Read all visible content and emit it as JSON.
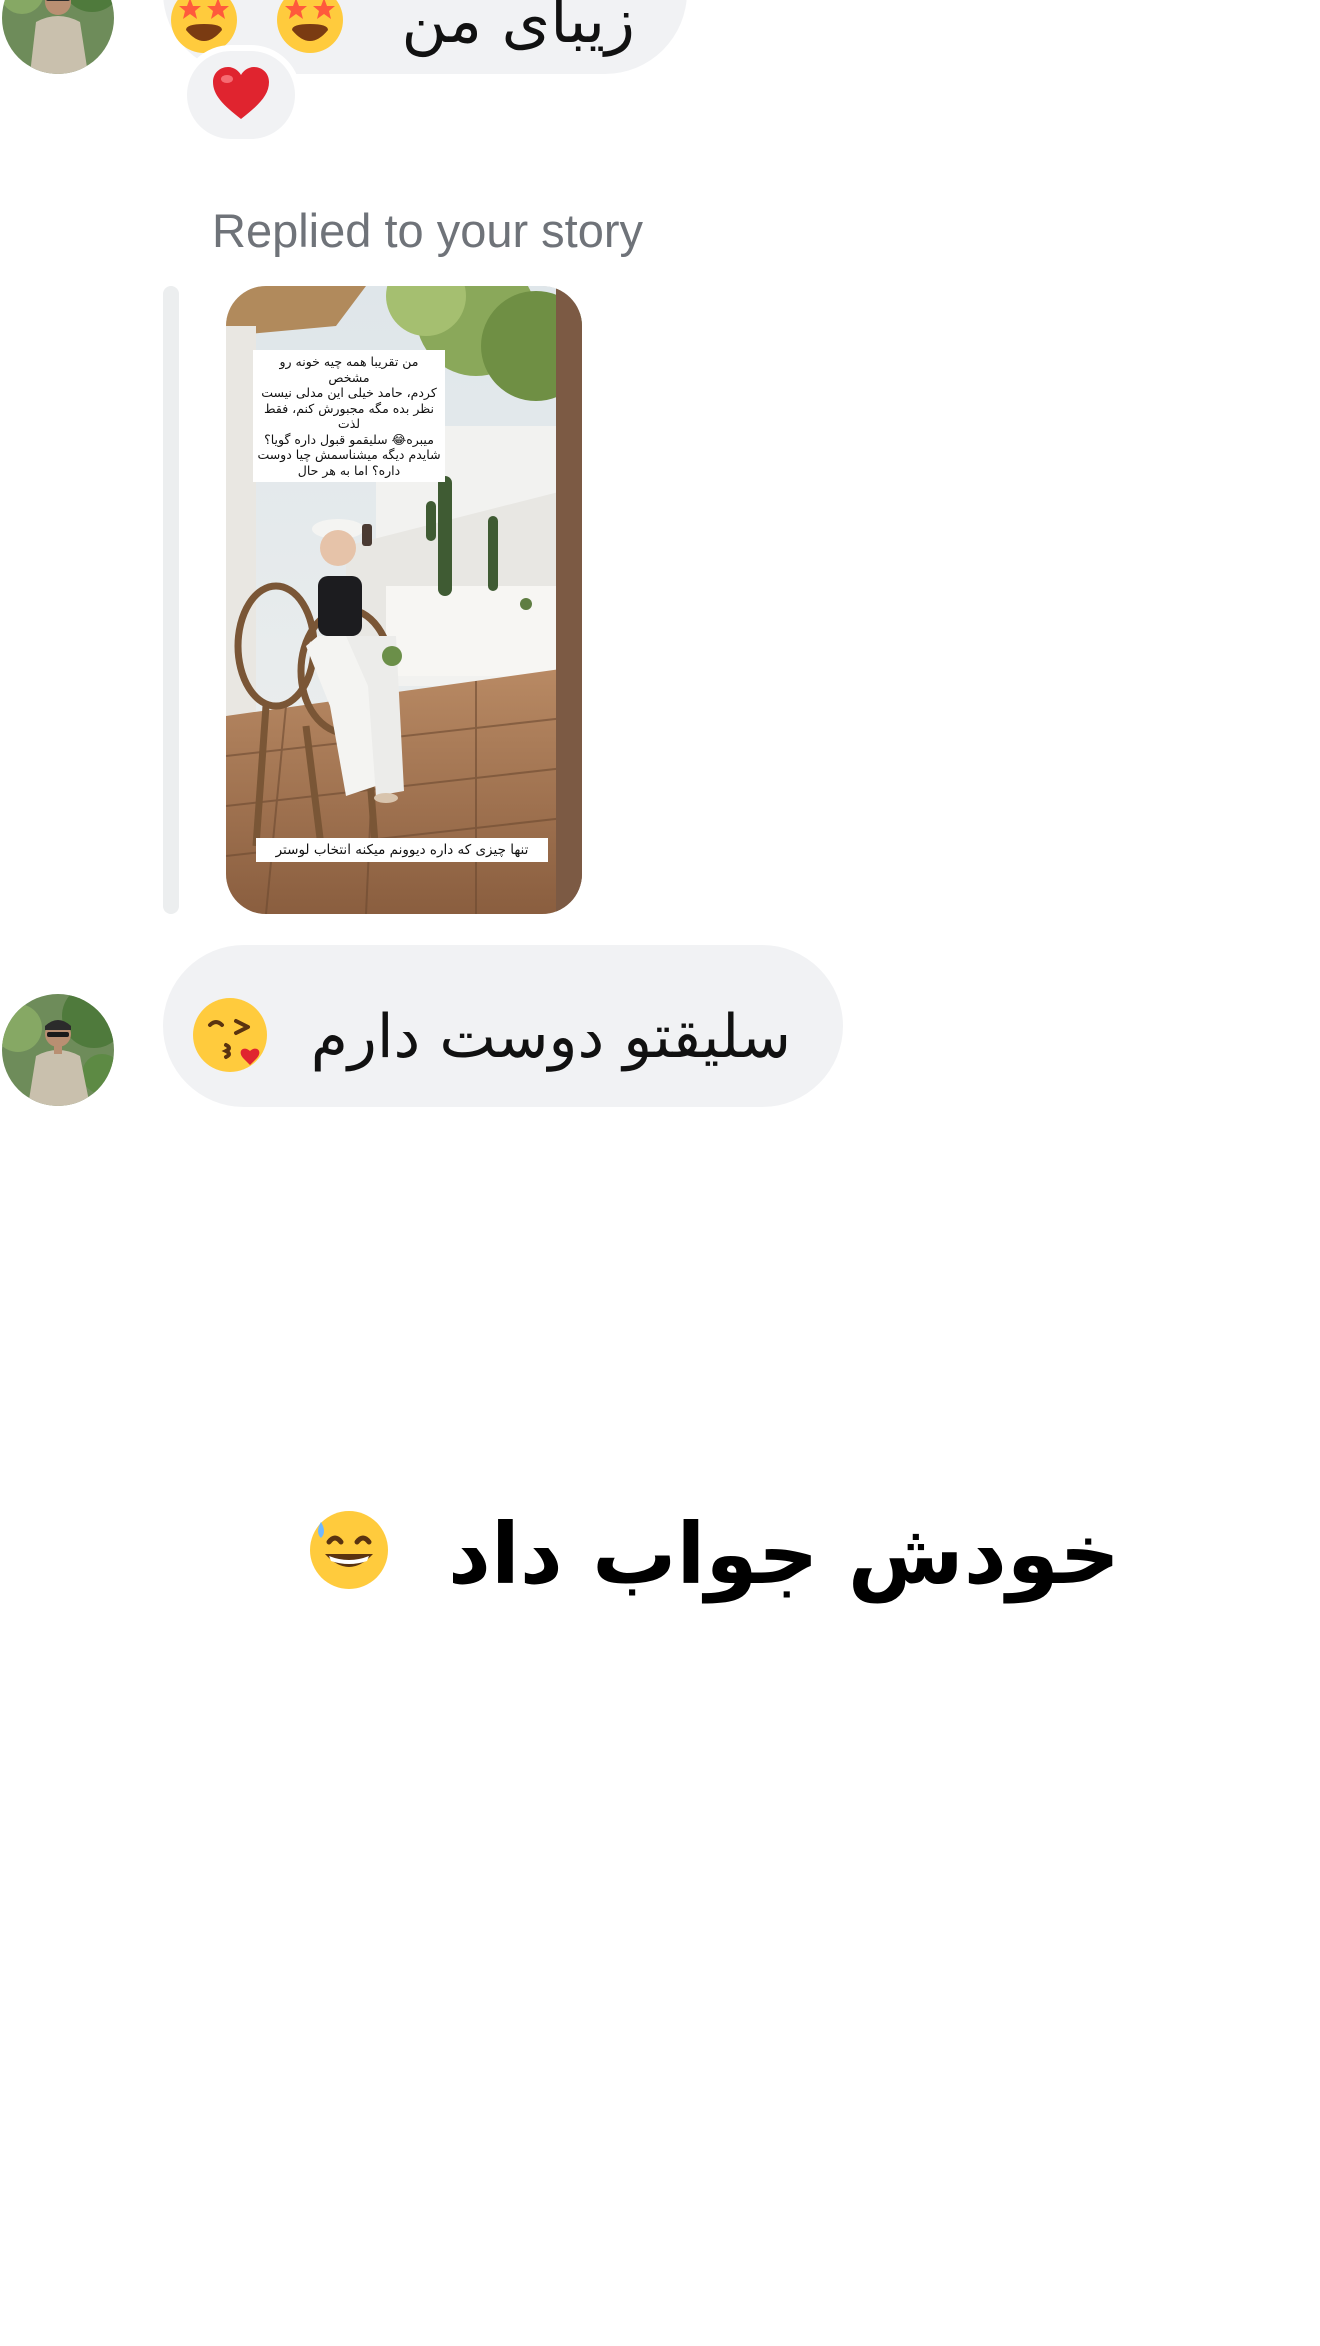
{
  "thread": {
    "top_message": {
      "text": "زیبای من",
      "emojis": [
        "star-struck-emoji",
        "star-struck-emoji"
      ]
    },
    "reaction": {
      "emoji": "red-heart-emoji"
    },
    "reply": {
      "label": "Replied to your story",
      "story": {
        "caption_lines": [
          "من تقریبا همه چیه خونه رو مشخص",
          "کردم، حامد خیلی این مدلی نیست",
          "نظر بده مگه مجبورش کنم، فقط لذت",
          "میبره😂 سلیقمو قبول داره گویا؟",
          "شایدم دیگه میشناسمش چیا دوست",
          "داره؟ اما به هر حال"
        ],
        "bottom_caption": "تنها چیزی که داره دیوونم میکنه انتخاب لوستر"
      }
    },
    "bottom_message": {
      "text": "سلیقتو دوست دارم",
      "emoji": "face-blowing-kiss-emoji"
    }
  },
  "overlay": {
    "caption": "خودش جواب داد",
    "emoji": "grinning-face-with-sweat-emoji"
  },
  "colors": {
    "background": "#ffffff",
    "bubble": "#f1f2f4",
    "label": "#6f7379",
    "quote_bar": "#eceeef",
    "heart": "#e0242f",
    "emoji_yellow": "#ffcb3d"
  }
}
